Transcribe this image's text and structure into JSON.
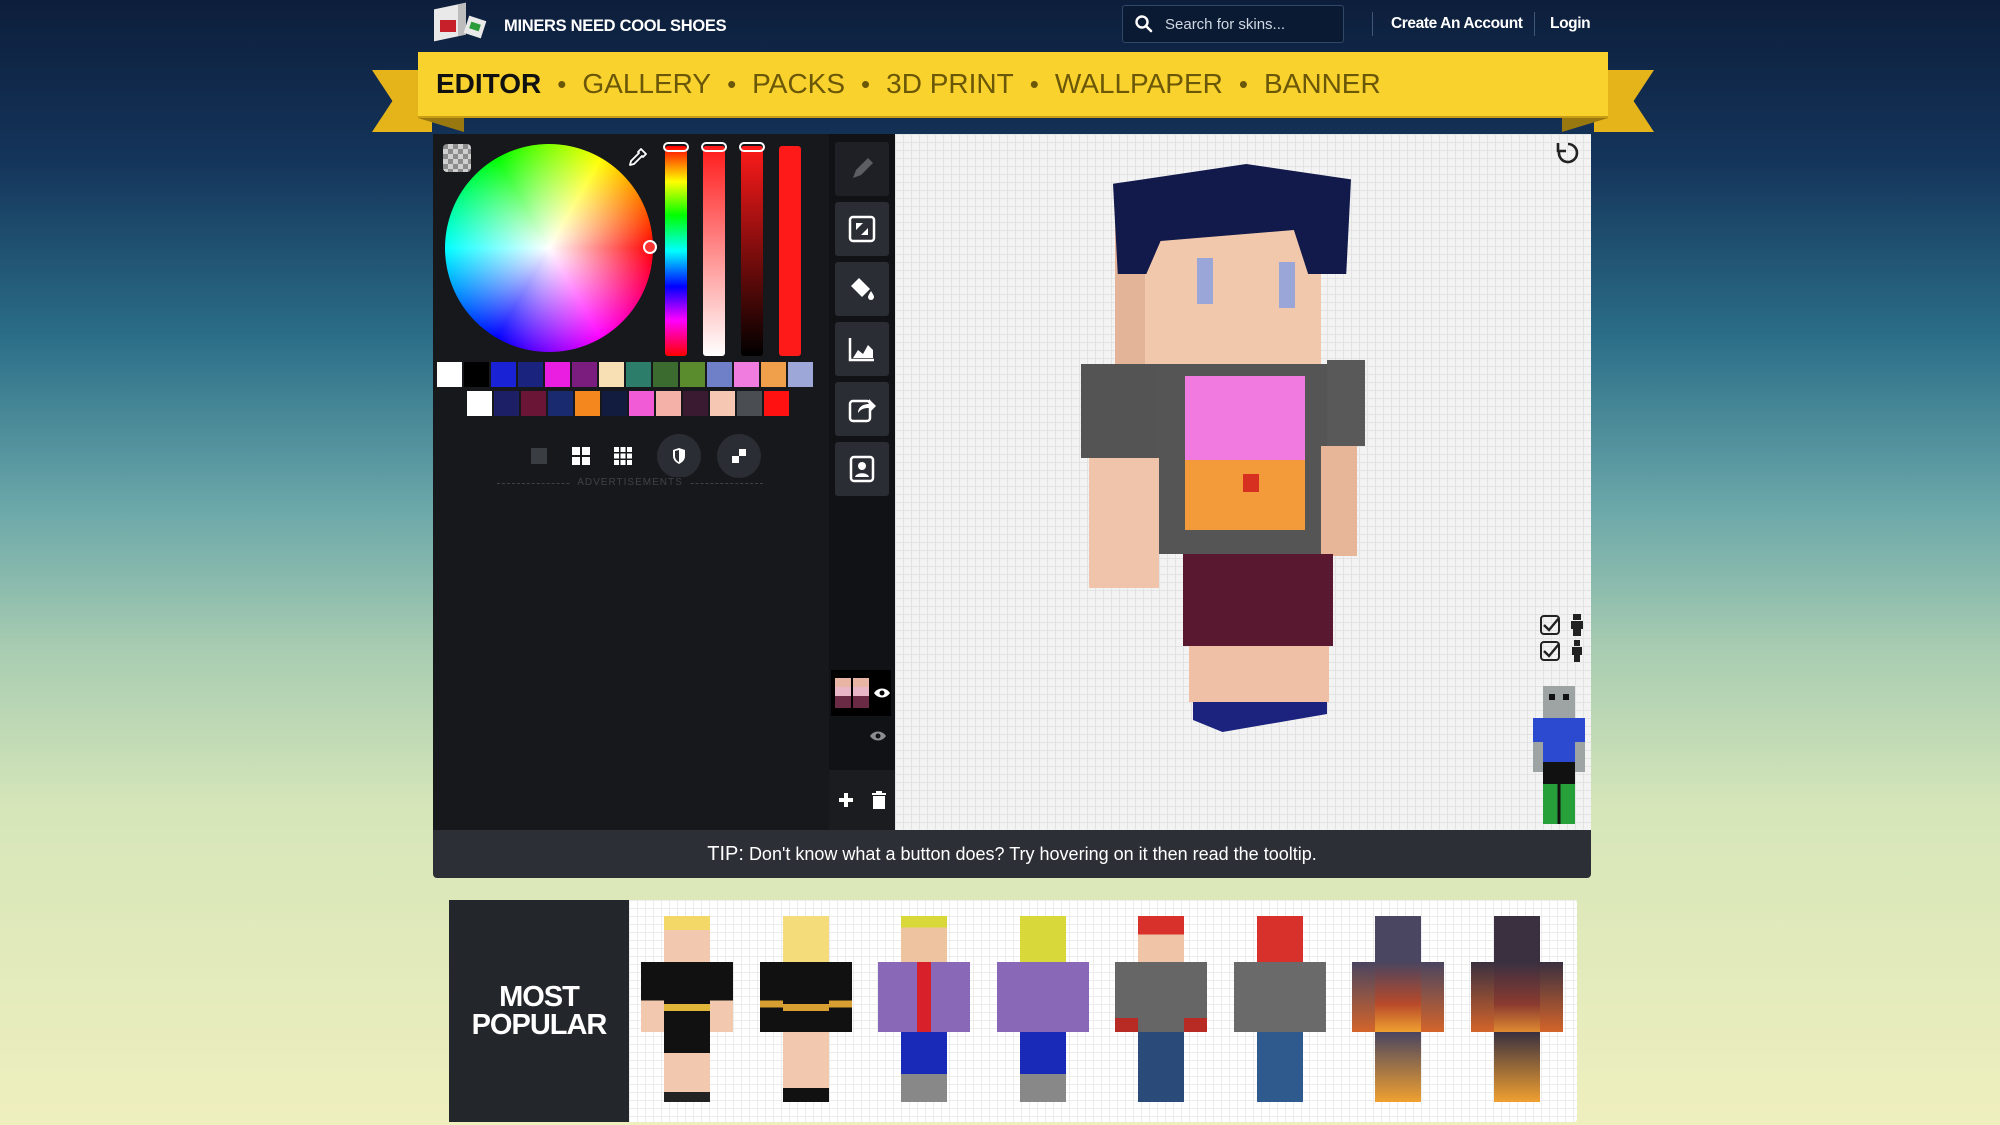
{
  "header": {
    "site_name": "MINERS NEED COOL SHOES",
    "search_placeholder": "Search for skins...",
    "create_account": "Create An Account",
    "login": "Login"
  },
  "nav": {
    "separator": "•",
    "items": [
      "EDITOR",
      "GALLERY",
      "PACKS",
      "3D PRINT",
      "WALLPAPER",
      "BANNER"
    ],
    "active": "EDITOR"
  },
  "editor": {
    "ads_label": "ADVERTISEMENTS",
    "selected_color": "#ff1a1a",
    "palette_row1": [
      "#ffffff",
      "#000000",
      "#1a22d6",
      "#1a237e",
      "#e91ee0",
      "#7b1d7e",
      "#f9dfb4",
      "#2d7d6b",
      "#3b6b2e",
      "#5a8c2e",
      "#6f7fc8",
      "#f07ce0",
      "#f0a04a",
      "#9ea8d8"
    ],
    "palette_row2": [
      "#ffffff",
      "#1c1f66",
      "#6a1436",
      "#1a2a6e",
      "#f5871f",
      "#111c3f",
      "#f25bd6",
      "#f3b1a7",
      "#3a1a30",
      "#f6c8b4",
      "#4a4d52",
      "#ff1111"
    ],
    "tools": [
      "pencil-tool",
      "transform-tool",
      "bucket-fill-tool",
      "noise-tool",
      "export-tool",
      "skin-upload-tool"
    ]
  },
  "tip": {
    "label": "TIP:",
    "text": "Don't know what a button does? Try hovering on it then read the tooltip."
  },
  "popular": {
    "title_line1": "MOST",
    "title_line2": "POPULAR"
  }
}
